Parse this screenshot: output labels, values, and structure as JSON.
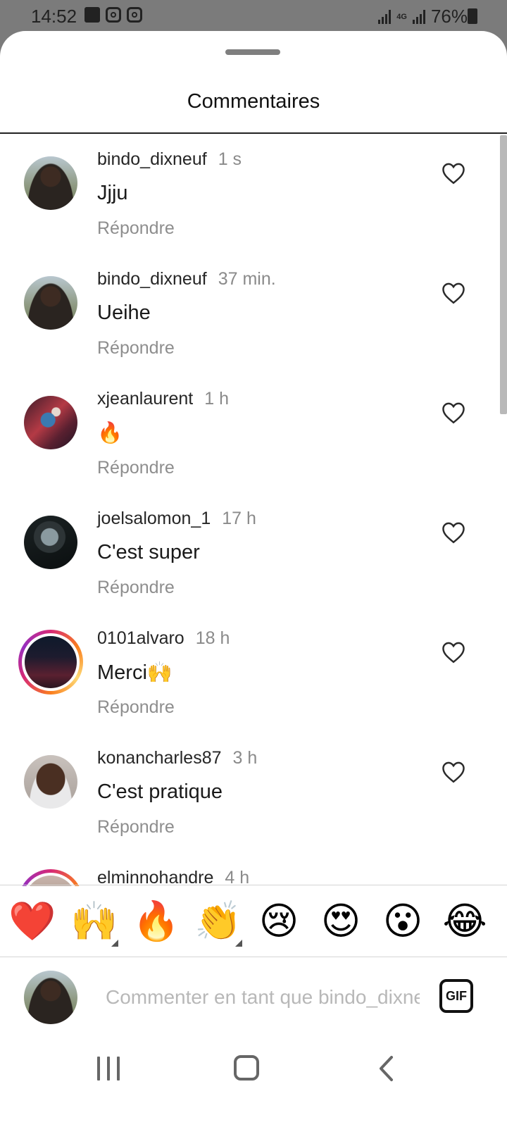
{
  "status_bar": {
    "time": "14:52",
    "network": "4G",
    "battery": "76%"
  },
  "sheet": {
    "title": "Commentaires"
  },
  "comments": [
    {
      "username": "bindo_dixneuf",
      "time": "1 s",
      "text": "Jjju",
      "reply": "Répondre"
    },
    {
      "username": "bindo_dixneuf",
      "time": "37 min.",
      "text": "Ueihe",
      "reply": "Répondre"
    },
    {
      "username": "xjeanlaurent",
      "time": "1 h",
      "text": "🔥",
      "reply": "Répondre"
    },
    {
      "username": "joelsalomon_1",
      "time": "17 h",
      "text": "C'est super",
      "reply": "Répondre"
    },
    {
      "username": "0101alvaro",
      "time": "18 h",
      "text": "Merci🙌",
      "reply": "Répondre"
    },
    {
      "username": "konancharles87",
      "time": "3 h",
      "text": "C'est pratique",
      "reply": "Répondre"
    },
    {
      "username": "elminnohandre",
      "time": "4 h",
      "text": "",
      "reply": ""
    }
  ],
  "emoji_bar": [
    "❤️",
    "🙌",
    "🔥",
    "👏",
    "😢",
    "😍",
    "😮",
    "😂"
  ],
  "composer": {
    "placeholder": "Commenter en tant que bindo_dixneuf...",
    "gif_label": "GIF"
  },
  "icons": {
    "like": "heart-outline-icon",
    "nav_recent": "recent-apps-icon",
    "nav_home": "home-icon",
    "nav_back": "back-icon"
  }
}
